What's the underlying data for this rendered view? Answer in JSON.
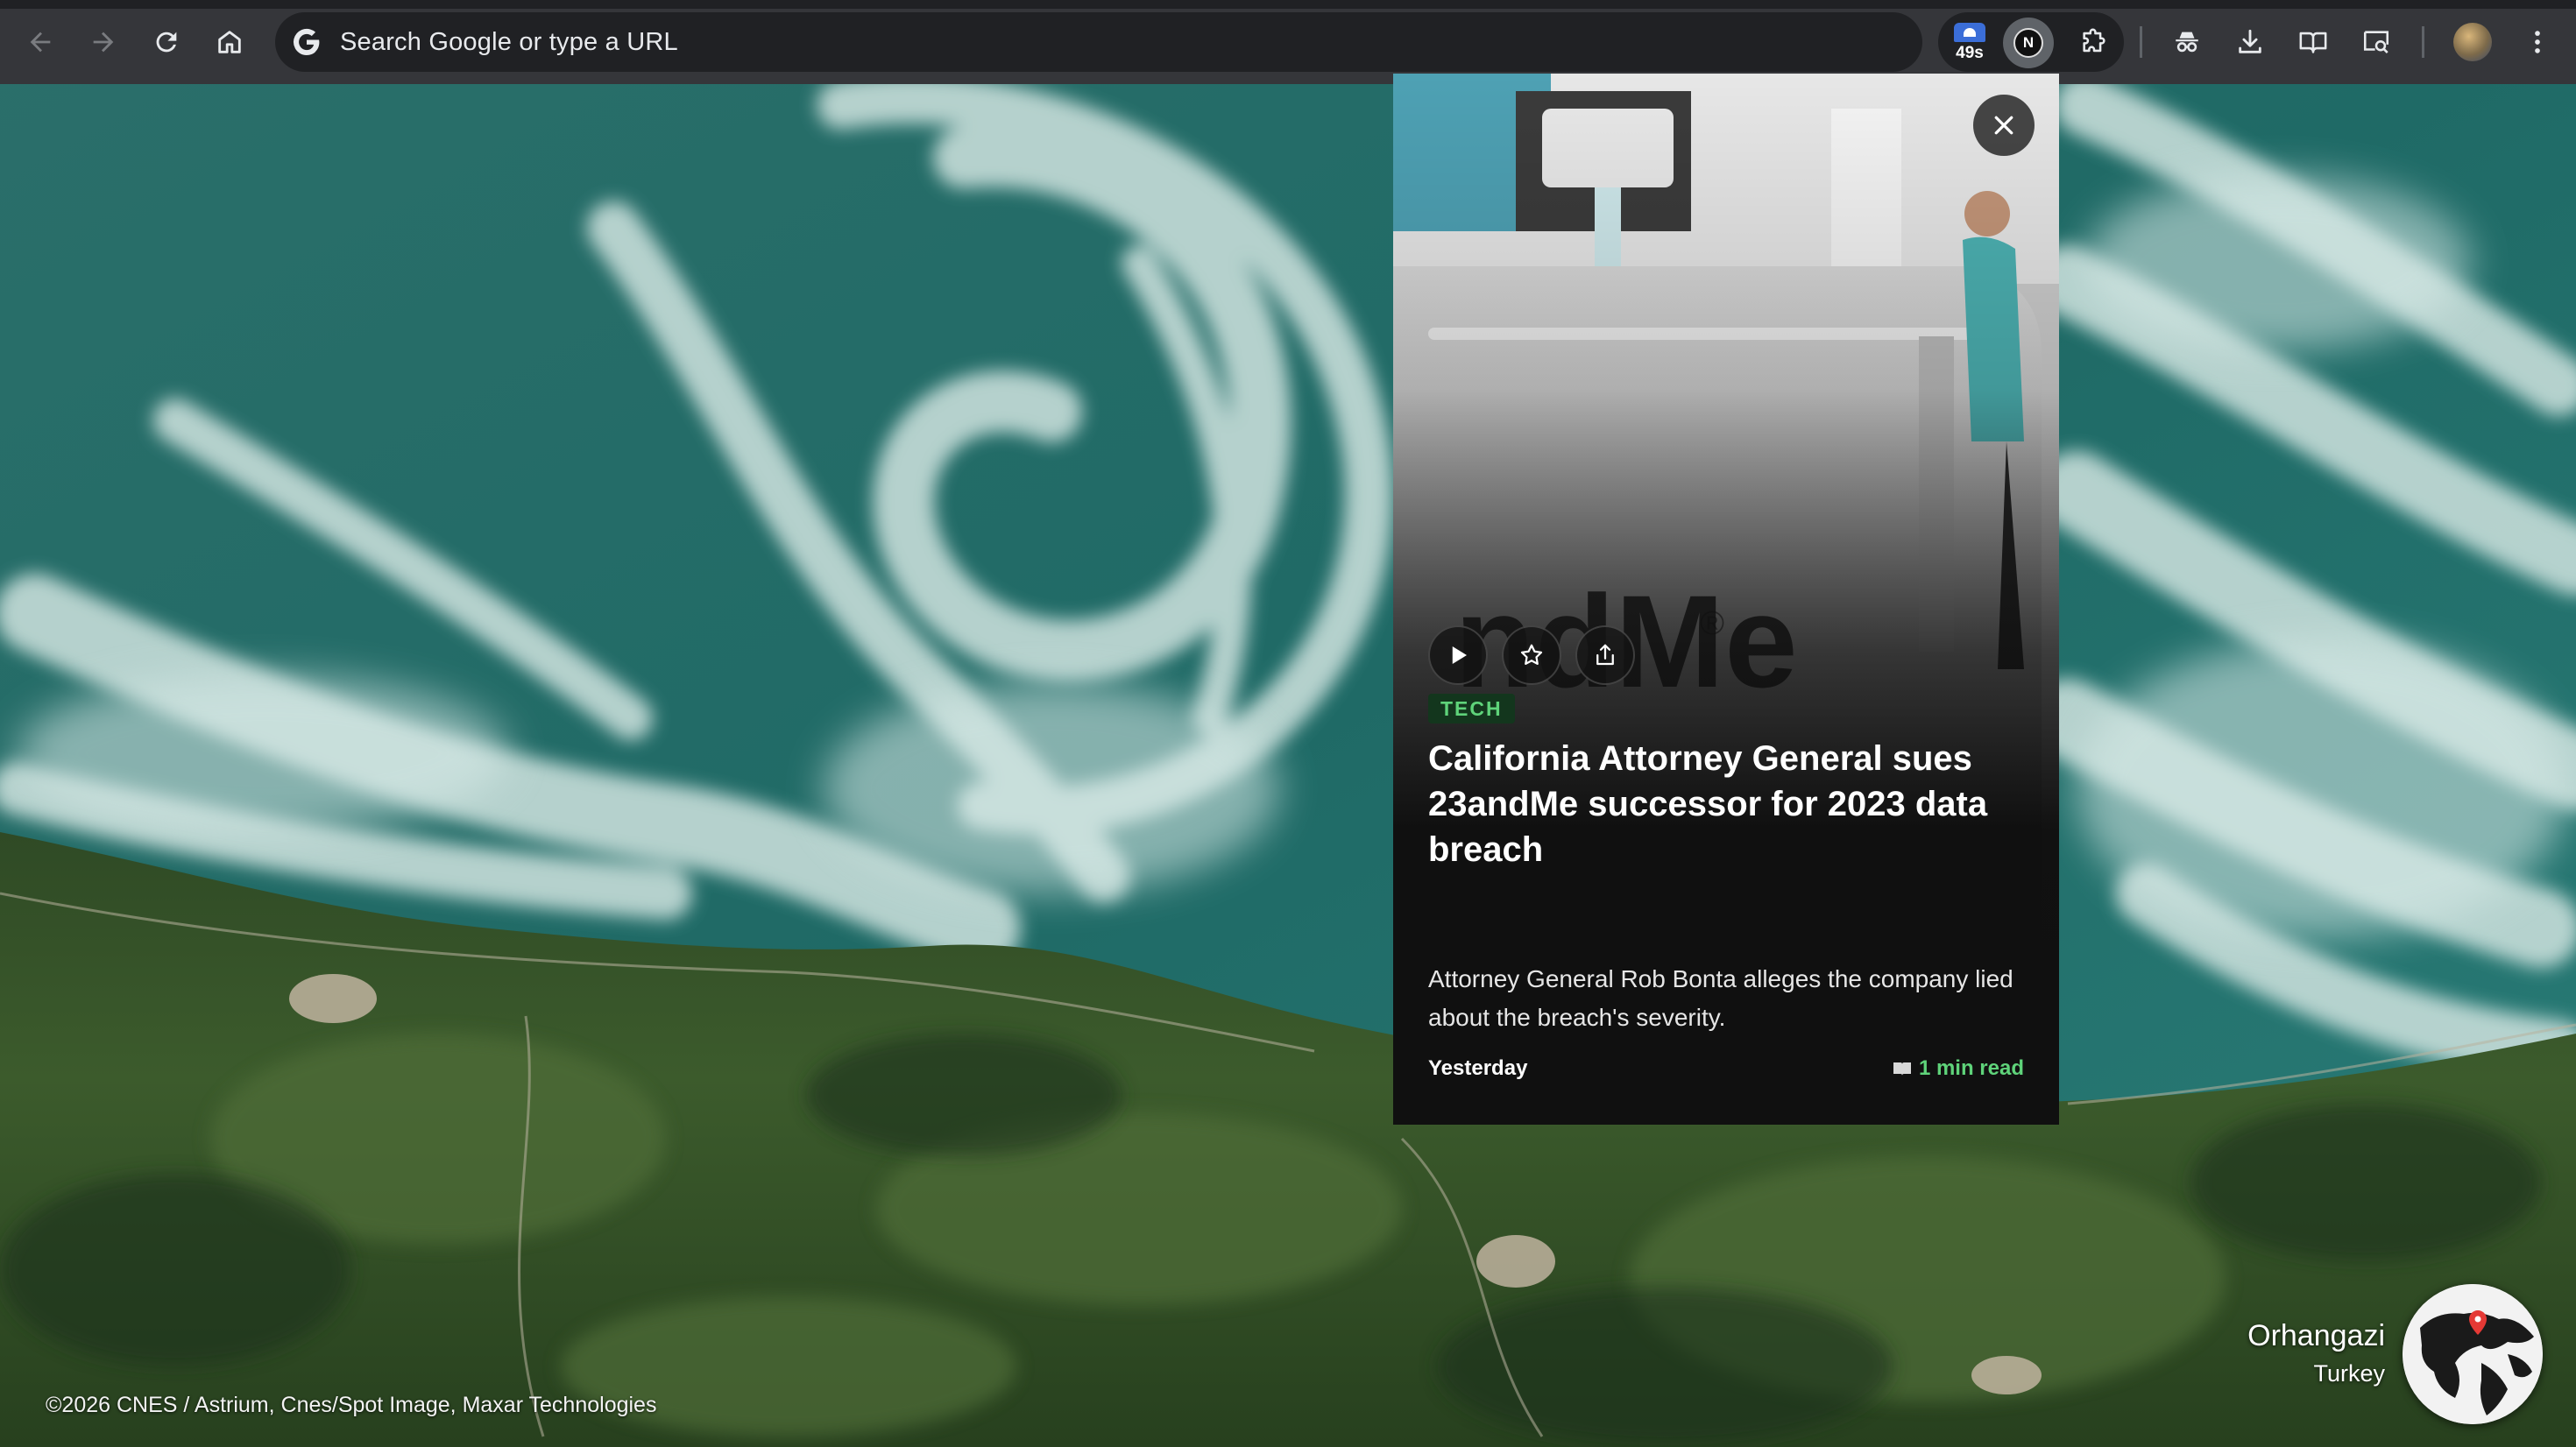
{
  "browser": {
    "omnibox": {
      "placeholder": "Search Google or type a URL"
    },
    "extensions": {
      "weather_temp": "49s",
      "n_badge": "N"
    },
    "icons": [
      "back-arrow-icon",
      "forward-arrow-icon",
      "reload-icon",
      "home-icon",
      "google-g-icon",
      "puzzle-extension-icon",
      "incognito-icon",
      "download-icon",
      "reading-list-icon",
      "tab-search-icon",
      "kebab-menu-icon"
    ]
  },
  "card": {
    "category": "TECH",
    "headline": "California Attorney General sues 23andMe successor for 2023 data breach",
    "summary": "Attorney General Rob Bonta alleges the company lied about the breach's severity.",
    "date": "Yesterday",
    "read_time": "1 min read",
    "accent_color": "#5fd37a"
  },
  "location": {
    "city": "Orhangazi",
    "country": "Turkey"
  },
  "attribution": "©2026 CNES / Astrium, Cnes/Spot Image, Maxar Technologies"
}
